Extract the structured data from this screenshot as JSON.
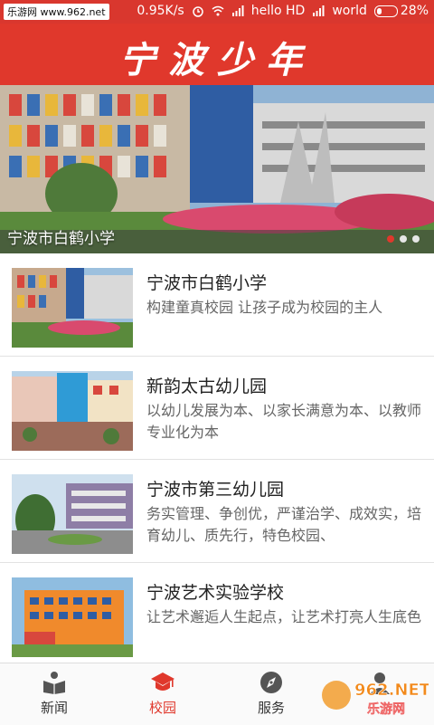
{
  "status_bar": {
    "watermark": "乐游网 www.962.net",
    "speed": "0.95K/s",
    "carrier1": "hello HD",
    "carrier2": "world",
    "battery": "28%",
    "battery_level": 0.28
  },
  "header": {
    "title": "宁波少年"
  },
  "banner": {
    "caption": "宁波市白鹤小学",
    "page_count": 3,
    "active_index": 0
  },
  "schools": [
    {
      "name": "宁波市白鹤小学",
      "desc": "构建童真校园 让孩子成为校园的主人"
    },
    {
      "name": "新韵太古幼儿园",
      "desc": "以幼儿发展为本、以家长满意为本、以教师专业化为本"
    },
    {
      "name": "宁波市第三幼儿园",
      "desc": "务实管理、争创优，严谨治学、成效实，培育幼儿、质先行，特色校园、"
    },
    {
      "name": "宁波艺术实验学校",
      "desc": "让艺术邂逅人生起点，让艺术打亮人生底色"
    }
  ],
  "tabs": [
    {
      "label": "新闻",
      "icon": "book-reader-icon"
    },
    {
      "label": "校园",
      "icon": "graduation-cap-icon"
    },
    {
      "label": "服务",
      "icon": "compass-icon"
    },
    {
      "label": "",
      "icon": "user-icon"
    }
  ],
  "watermark_br": "962.NET 乐游网",
  "colors": {
    "accent": "#e0382c",
    "statusbar": "#d9372e"
  }
}
